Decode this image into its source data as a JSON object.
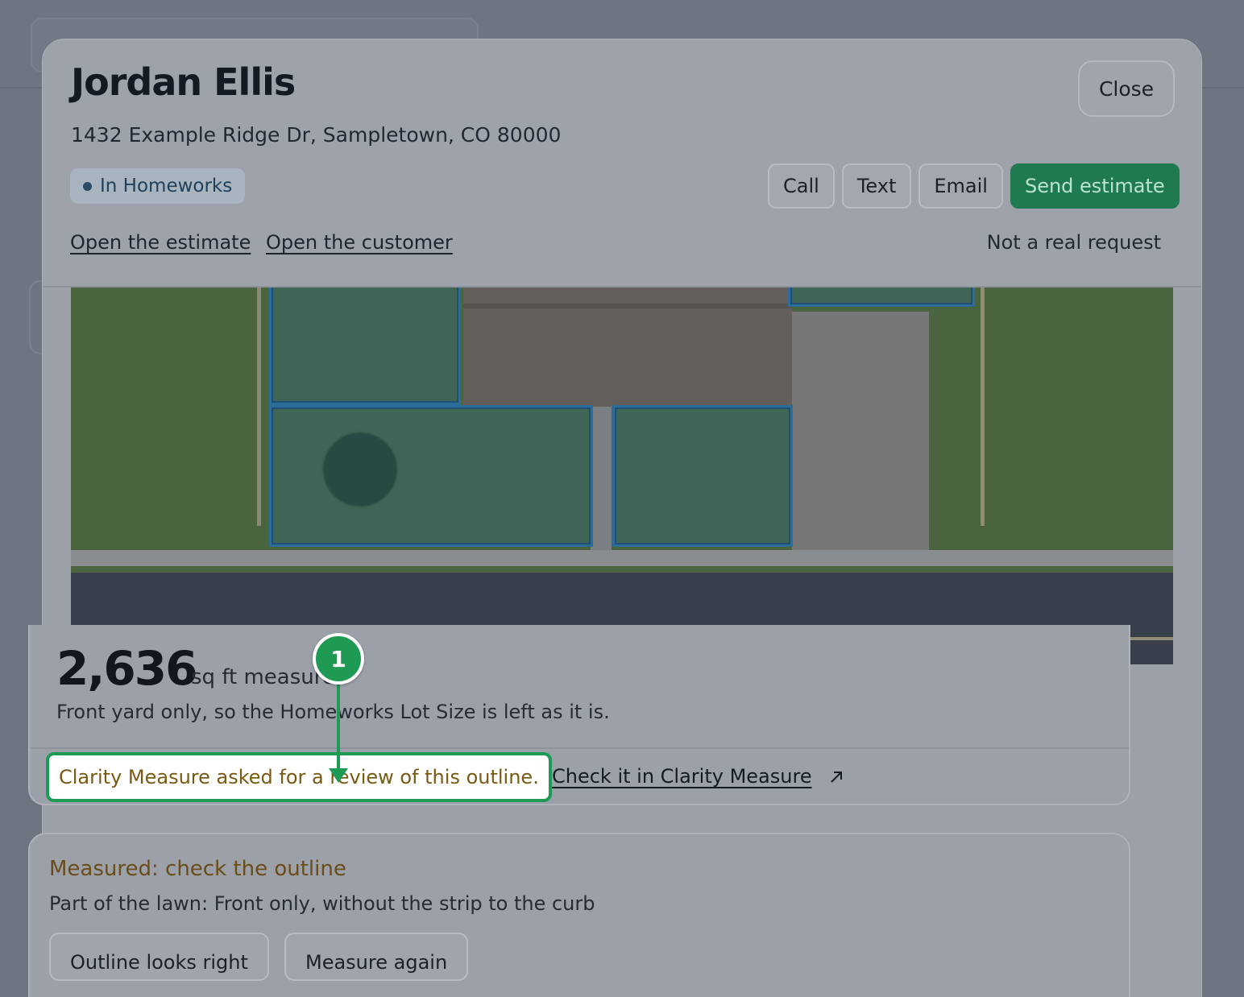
{
  "background": {},
  "header": {
    "name": "Jordan Ellis",
    "address": "1432 Example Ridge Dr, Sampletown, CO 80000",
    "badge": "In Homeworks",
    "close_label": "Close",
    "actions": {
      "call": "Call",
      "text": "Text",
      "email": "Email",
      "send_estimate": "Send estimate"
    },
    "links": {
      "open_estimate": "Open the estimate",
      "open_customer": "Open the customer"
    },
    "not_real": "Not a real request"
  },
  "stats": {
    "area": "2,636",
    "unit": "sq ft measured",
    "note": "Front yard only, so the Homeworks Lot Size is left as it is.",
    "review_message": "Clarity Measure asked for a review of this outline.",
    "check_link": "Check it in Clarity Measure"
  },
  "callout": {
    "number": "1",
    "color": "#1f9a55"
  },
  "measured": {
    "title": "Measured: check the outline",
    "subtitle": "Part of the lawn: Front only, without the strip to the curb",
    "buttons": {
      "looks_right": "Outline looks right",
      "measure_again": "Measure again"
    }
  },
  "colors": {
    "primary": "#1f7a50",
    "review_text": "#7a5a12",
    "lawn_outline": "#2c6c98"
  }
}
